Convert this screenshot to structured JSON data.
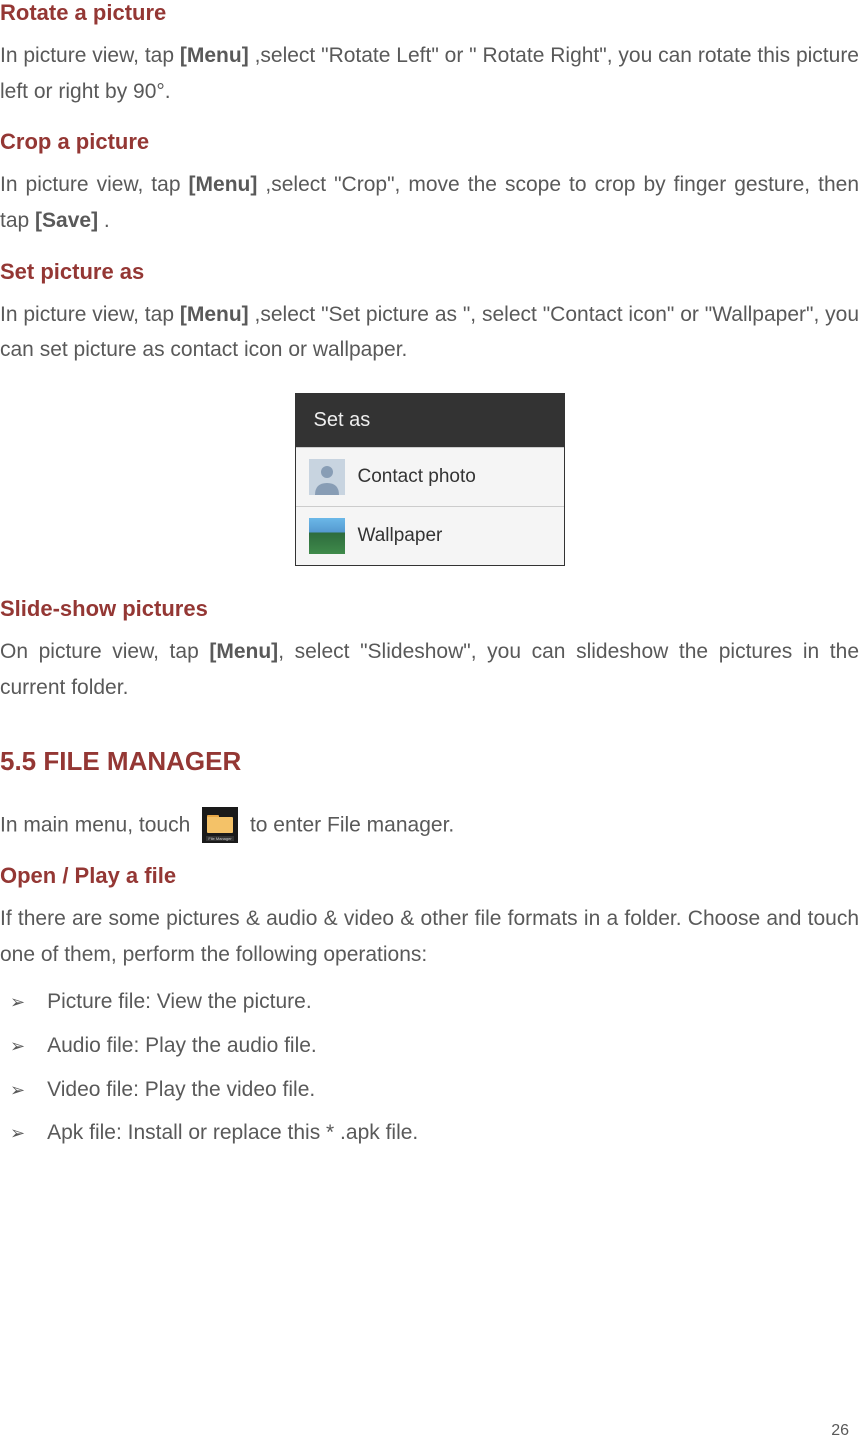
{
  "sections": {
    "rotate": {
      "heading": "Rotate a picture",
      "text_parts": {
        "p1": "In picture view, tap ",
        "menu": "[Menu]",
        "p2": " ,select \"Rotate Left\" or \" Rotate Right\", you can rotate this picture left or right by 90°."
      }
    },
    "crop": {
      "heading": "Crop a picture",
      "text_parts": {
        "p1": "In picture view, tap ",
        "menu": "[Menu]",
        "p2": " ,select \"Crop\", move the scope to crop by finger gesture, then tap ",
        "save": "[Save]",
        "p3": " ."
      }
    },
    "set_as": {
      "heading": "Set picture as",
      "text_parts": {
        "p1": "In picture view, tap ",
        "menu": "[Menu]",
        "p2": " ,select \"Set picture as \", select \"Contact icon\" or \"Wallpaper\", you can set picture as contact icon or wallpaper."
      }
    },
    "slideshow": {
      "heading": "Slide-show pictures",
      "text_parts": {
        "p1": "On picture view, tap ",
        "menu": "[Menu]",
        "p2": ", select \"Slideshow\", you can slideshow the pictures in the current folder."
      }
    },
    "file_manager": {
      "heading": "5.5 FILE MANAGER",
      "intro_parts": {
        "p1": "In main menu, touch ",
        "p2": " to enter File manager."
      }
    },
    "open_file": {
      "heading": "Open / Play a file",
      "text": "If there are some pictures & audio & video & other file formats in a folder. Choose and touch one of them, perform the following operations:",
      "list": [
        "Picture file: View the picture.",
        "Audio file: Play the audio file.",
        "Video file: Play the video file.",
        "Apk file: Install or replace this * .apk file."
      ]
    }
  },
  "set_as_dialog": {
    "title": "Set as",
    "option1": "Contact photo",
    "option2": "Wallpaper"
  },
  "page_number": "26"
}
